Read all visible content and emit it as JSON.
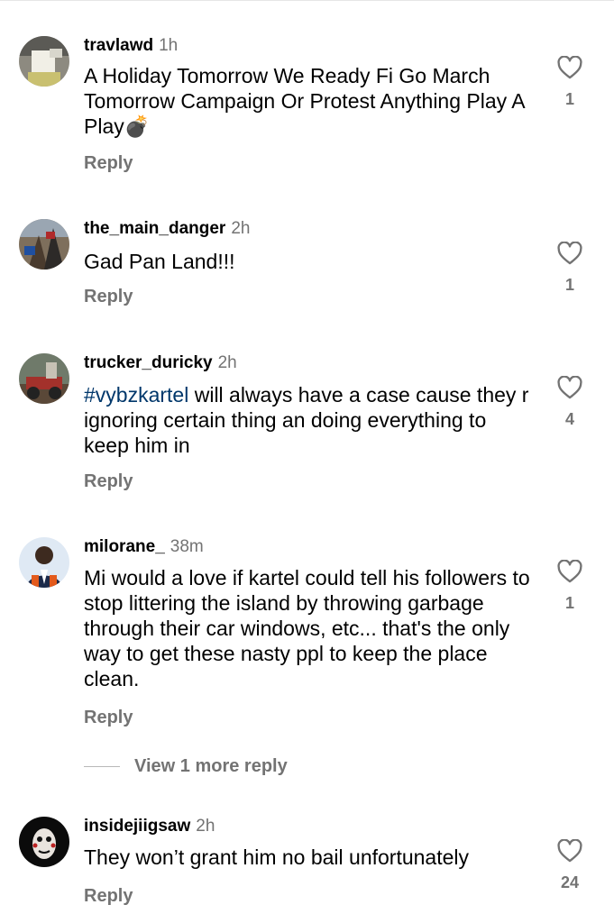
{
  "comments": [
    {
      "username": "travlawd",
      "time": "1h",
      "text": "A Holiday Tomorrow We Ready Fi Go March Tomorrow Campaign Or Protest Anything Play A Play",
      "emoji": "💣",
      "reply_label": "Reply",
      "likes": "1",
      "icon": "heart-outline-icon"
    },
    {
      "username": "the_main_danger",
      "time": "2h",
      "text": "Gad Pan Land!!!",
      "reply_label": "Reply",
      "likes": "1",
      "icon": "heart-outline-icon"
    },
    {
      "username": "trucker_duricky",
      "time": "2h",
      "hashtag": "#vybzkartel",
      "text": " will always have a case cause they r ignoring certain thing an doing everything to keep him in",
      "reply_label": "Reply",
      "likes": "4",
      "icon": "heart-outline-icon"
    },
    {
      "username": "milorane_",
      "time": "38m",
      "text": "Mi would a love if kartel could tell his followers to stop littering the island by throwing garbage through their car windows, etc... that's the only way to get these nasty ppl to keep the place clean.",
      "reply_label": "Reply",
      "likes": "1",
      "icon": "heart-outline-icon"
    },
    {
      "username": "insidejiigsaw",
      "time": "2h",
      "text": "They won’t grant him no bail unfortunately",
      "reply_label": "Reply",
      "likes": "24",
      "icon": "heart-outline-icon"
    }
  ],
  "view_more_label": "View 1 more reply",
  "colors": {
    "secondary_text": "#737373",
    "hashtag": "#00376b",
    "primary_text": "#000000"
  }
}
